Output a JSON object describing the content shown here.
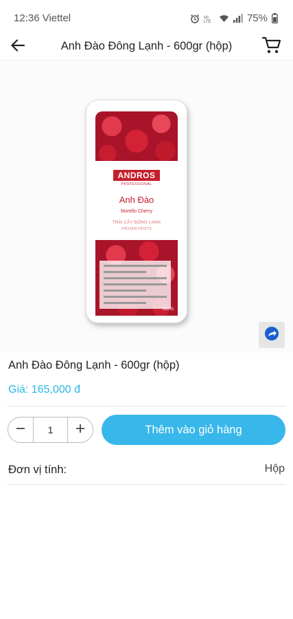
{
  "status_bar": {
    "time": "12:36",
    "carrier": "Viettel",
    "battery": "75%"
  },
  "header": {
    "title": "Anh Đào Đông Lạnh - 600gr (hộp)",
    "back_icon": "arrow-left-icon",
    "cart_icon": "cart-icon"
  },
  "product_image": {
    "brand": "ANDROS",
    "brand_sub": "PROFESSIONAL",
    "name": "Anh Đào",
    "variety": "Morello Cherry",
    "line1": "TRÁI CÂY ĐÔNG LẠNH",
    "line2": "FROZEN FRUITS",
    "weight": "550 G"
  },
  "product": {
    "title": "Anh Đào Đông Lạnh - 600gr (hộp)",
    "price": "Giá: 165,000 đ"
  },
  "cart_controls": {
    "quantity": "1",
    "add_label": "Thêm vào giỏ hàng"
  },
  "unit": {
    "label": "Đơn vị tính:",
    "value": "Hộp"
  },
  "colors": {
    "accent": "#38b7ea",
    "price": "#2bb6e6"
  }
}
